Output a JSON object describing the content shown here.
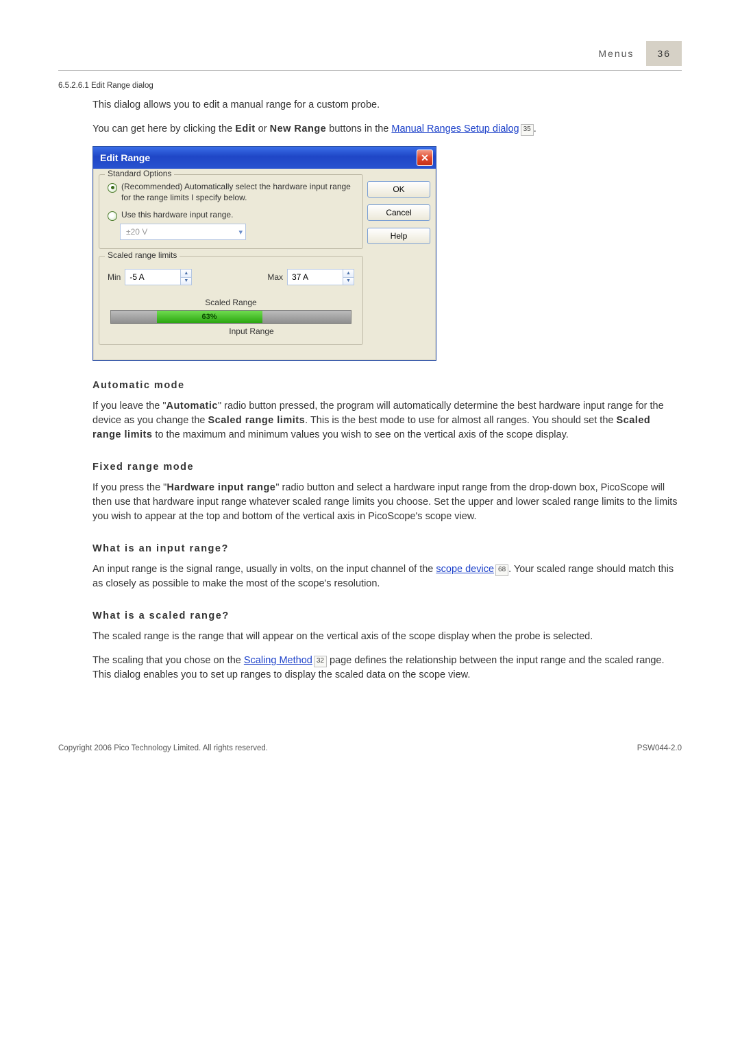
{
  "header": {
    "section": "Menus",
    "page_num": "36"
  },
  "section_num": "6.5.2.6.1  Edit Range dialog",
  "intro1": "This dialog allows you to edit a manual range for a custom probe.",
  "intro2a": "You can get here by clicking the ",
  "intro2b": " or ",
  "intro2c": " buttons in the ",
  "edit_word": "Edit",
  "newrange_word": "New Range",
  "link1": "Manual Ranges Setup dialog",
  "ref1": "35",
  "dialog": {
    "title": "Edit Range",
    "ok": "OK",
    "cancel": "Cancel",
    "help": "Help",
    "group1": "Standard Options",
    "opt1": "(Recommended) Automatically select the hardware input range for the range limits I specify below.",
    "opt2": "Use this hardware input range.",
    "combo": "±20 V",
    "group2": "Scaled range limits",
    "min_lbl": "Min",
    "max_lbl": "Max",
    "min_val": "-5 A",
    "max_val": "37 A",
    "scaled_caption": "Scaled Range",
    "percent": "63%",
    "input_caption": "Input Range"
  },
  "h1": "Automatic mode",
  "p1a": "If you leave the \"",
  "p1b": "\" radio button pressed, the program will automatically determine the best hardware input range for the device as you change the ",
  "p1c": ". This is the best mode to use for almost all ranges. You should set the ",
  "p1d": " to the maximum and minimum values you wish to see on the vertical axis of the scope display.",
  "strong_auto": "Automatic",
  "strong_srl": "Scaled range limits",
  "strong_srl2": "Scaled range limits",
  "h2": "Fixed range mode",
  "p2a": "If you press the \"",
  "p2b": "\" radio button and select a hardware input range from the drop-down box, PicoScope will then use that hardware input range whatever scaled range limits you choose. Set the upper and lower scaled range limits to the limits you wish to appear at the top and bottom of the vertical axis in PicoScope's scope view.",
  "strong_hir": "Hardware input range",
  "h3": "What is an input range?",
  "p3a": "An input range is the signal range, usually in volts, on the input channel of the ",
  "link2": "scope device",
  "ref2": "68",
  "p3b": ". Your scaled range should match this as closely as possible to make the most of the scope's resolution.",
  "h4": "What is a scaled range?",
  "p4": "The scaled range is the range that will appear on the vertical axis of the scope display when the probe is selected.",
  "p5a": "The scaling that you chose on the ",
  "link3": "Scaling Method",
  "ref3": "32",
  "p5b": " page defines the relationship between the input range and the scaled range. This dialog enables you to set up ranges to display the scaled data on the scope view.",
  "footer": {
    "left": "Copyright 2006 Pico Technology Limited. All rights reserved.",
    "right": "PSW044-2.0"
  }
}
